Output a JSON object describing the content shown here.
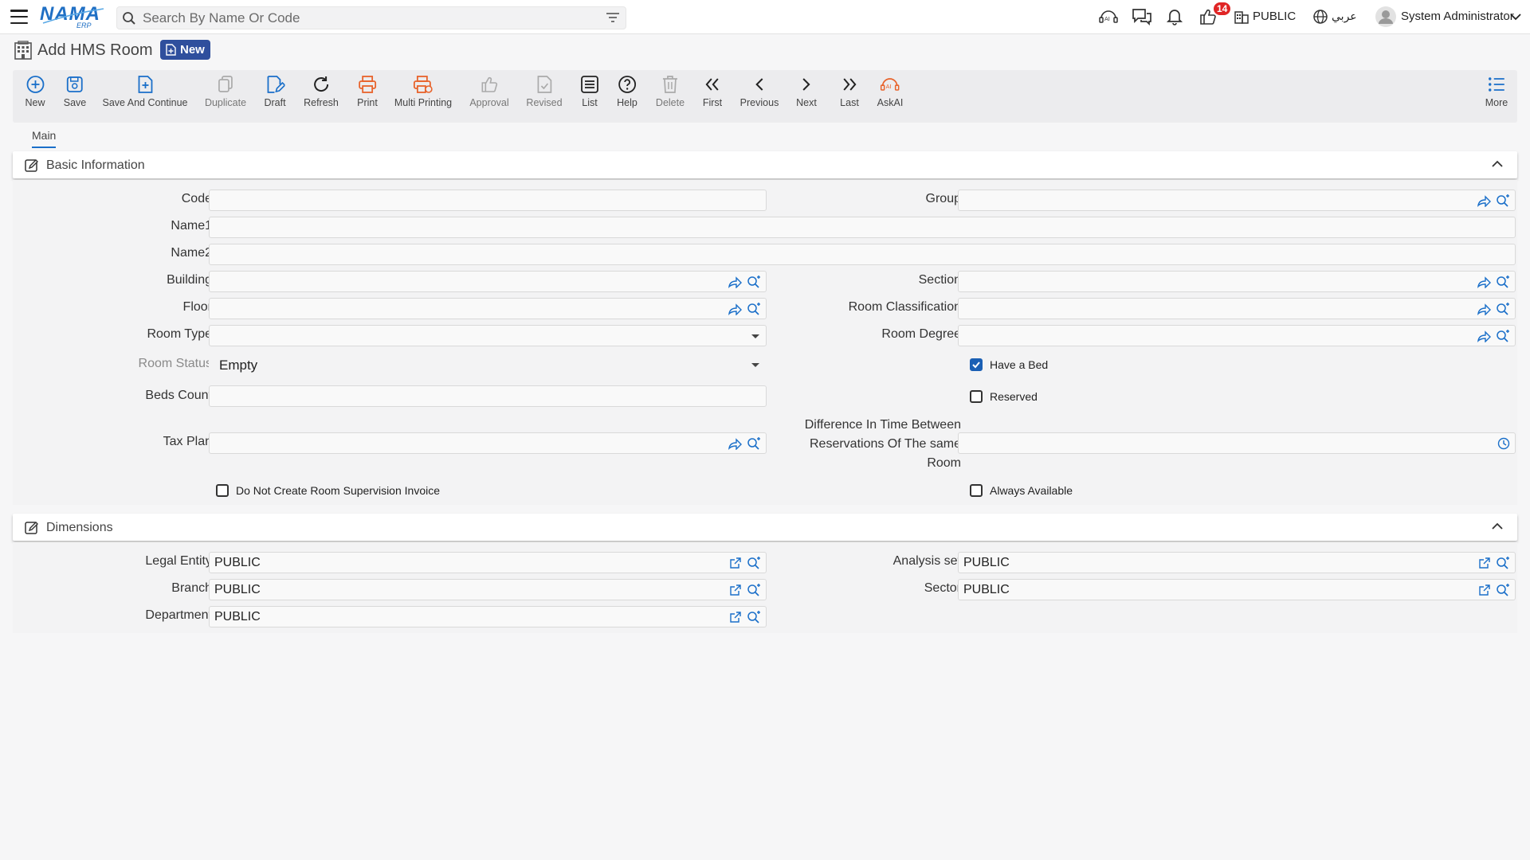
{
  "header": {
    "logo_text": "NAMA",
    "logo_sub": "ERP",
    "search_placeholder": "Search By Name Or Code",
    "notification_count": "14",
    "company": "PUBLIC",
    "language": "عربي",
    "user": "System Administrator"
  },
  "page": {
    "title": "Add HMS Room",
    "status_badge": "New"
  },
  "toolbar": {
    "new": "New",
    "save": "Save",
    "save_continue": "Save And Continue",
    "duplicate": "Duplicate",
    "draft": "Draft",
    "refresh": "Refresh",
    "print": "Print",
    "multi_printing": "Multi Printing",
    "approval": "Approval",
    "revised": "Revised",
    "list": "List",
    "help": "Help",
    "delete": "Delete",
    "first": "First",
    "previous": "Previous",
    "next": "Next",
    "last": "Last",
    "askai": "AskAI",
    "more": "More"
  },
  "tabs": {
    "main": "Main"
  },
  "basic": {
    "title": "Basic Information",
    "code_label": "Code",
    "code_value": "",
    "group_label": "Group",
    "group_value": "",
    "name1_label": "Name1",
    "name1_value": "",
    "name2_label": "Name2",
    "name2_value": "",
    "building_label": "Building",
    "building_value": "",
    "section_label": "Section",
    "section_value": "",
    "floor_label": "Floor",
    "floor_value": "",
    "room_classification_label": "Room Classification",
    "room_classification_value": "",
    "room_type_label": "Room Type",
    "room_type_value": "",
    "room_degree_label": "Room Degree",
    "room_degree_value": "",
    "room_status_label": "Room Status",
    "room_status_value": "Empty",
    "have_bed_label": "Have a Bed",
    "have_bed_checked": true,
    "beds_count_label": "Beds Count",
    "beds_count_value": "",
    "reserved_label": "Reserved",
    "reserved_checked": false,
    "tax_plan_label": "Tax Plan",
    "tax_plan_value": "",
    "time_diff_label_1": "Difference In Time Between",
    "time_diff_label_2": "Reservations Of The same",
    "time_diff_label_3": "Room",
    "time_diff_value": "",
    "no_supervision_label": "Do Not Create Room Supervision Invoice",
    "no_supervision_checked": false,
    "always_available_label": "Always Available",
    "always_available_checked": false
  },
  "dimensions": {
    "title": "Dimensions",
    "legal_entity_label": "Legal Entity",
    "legal_entity_value": "PUBLIC",
    "analysis_set_label": "Analysis set",
    "analysis_set_value": "PUBLIC",
    "branch_label": "Branch",
    "branch_value": "PUBLIC",
    "sector_label": "Sector",
    "sector_value": "PUBLIC",
    "department_label": "Department",
    "department_value": "PUBLIC"
  },
  "colors": {
    "primary_blue": "#1a6fc9",
    "badge_blue": "#2f4f9d",
    "print_orange": "#e8632b",
    "notification_red": "#e02525"
  }
}
